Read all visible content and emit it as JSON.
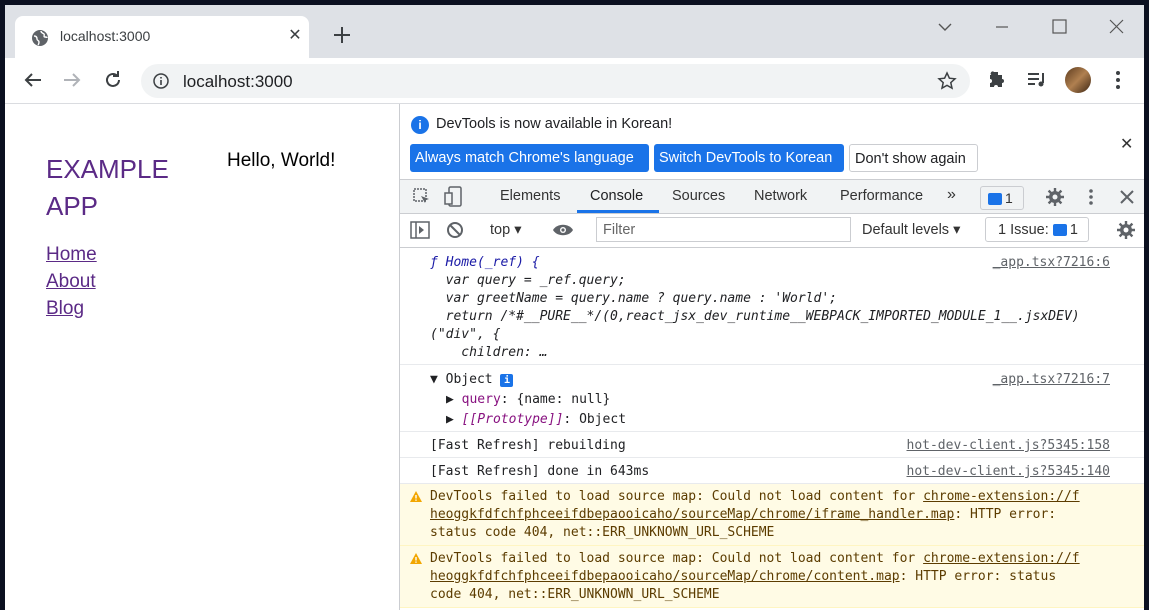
{
  "browser": {
    "tab_title": "localhost:3000",
    "url": "localhost:3000"
  },
  "page": {
    "brand_line1": "EXAMPLE",
    "brand_line2": "APP",
    "hello": "Hello, World!",
    "nav": [
      "Home",
      "About",
      "Blog"
    ]
  },
  "devtools": {
    "infobar_message": "DevTools is now available in Korean!",
    "btn_match": "Always match Chrome's language",
    "btn_switch": "Switch DevTools to Korean",
    "btn_dont_show": "Don't show again",
    "tabs": [
      "Elements",
      "Console",
      "Sources",
      "Network",
      "Performance"
    ],
    "active_tab": "Console",
    "message_count": "1",
    "context": "top",
    "filter_placeholder": "Filter",
    "levels": "Default levels",
    "issues_label": "1 Issue:",
    "issues_count": "1"
  },
  "console": {
    "fn_lines": [
      "ƒ Home(_ref) {",
      "  var query = _ref.query;",
      "  var greetName = query.name ? query.name : 'World';",
      "  return /*#__PURE__*/(0,react_jsx_dev_runtime__WEBPACK_IMPORTED_MODULE_1__.jsxDEV)",
      "(\"div\", {",
      "    children: …"
    ],
    "fn_src": "_app.tsx?7216:6",
    "obj_label": "Object",
    "obj_src": "_app.tsx?7216:7",
    "obj_query_key": "query",
    "obj_query_val": "{name: null}",
    "obj_proto_key": "[[Prototype]]",
    "obj_proto_val": "Object",
    "fr1": "[Fast Refresh] rebuilding",
    "fr1_src": "hot-dev-client.js?5345:158",
    "fr2": "[Fast Refresh] done in 643ms",
    "fr2_src": "hot-dev-client.js?5345:140",
    "warn1_a": "DevTools failed to load source map: Could not load content for ",
    "warn1_link1": "chrome-extension://f",
    "warn1_link2": "heoggkfdfchfphceeifdbepaooicaho/sourceMap/chrome/iframe_handler.map",
    "warn1_b": ": HTTP error:",
    "warn1_c": "status code 404, net::ERR_UNKNOWN_URL_SCHEME",
    "warn2_a": "DevTools failed to load source map: Could not load content for ",
    "warn2_link1": "chrome-extension://f",
    "warn2_link2": "heoggkfdfchfphceeifdbepaooicaho/sourceMap/chrome/content.map",
    "warn2_b": ": HTTP error: status",
    "warn2_c": "code 404, net::ERR_UNKNOWN_URL_SCHEME"
  }
}
